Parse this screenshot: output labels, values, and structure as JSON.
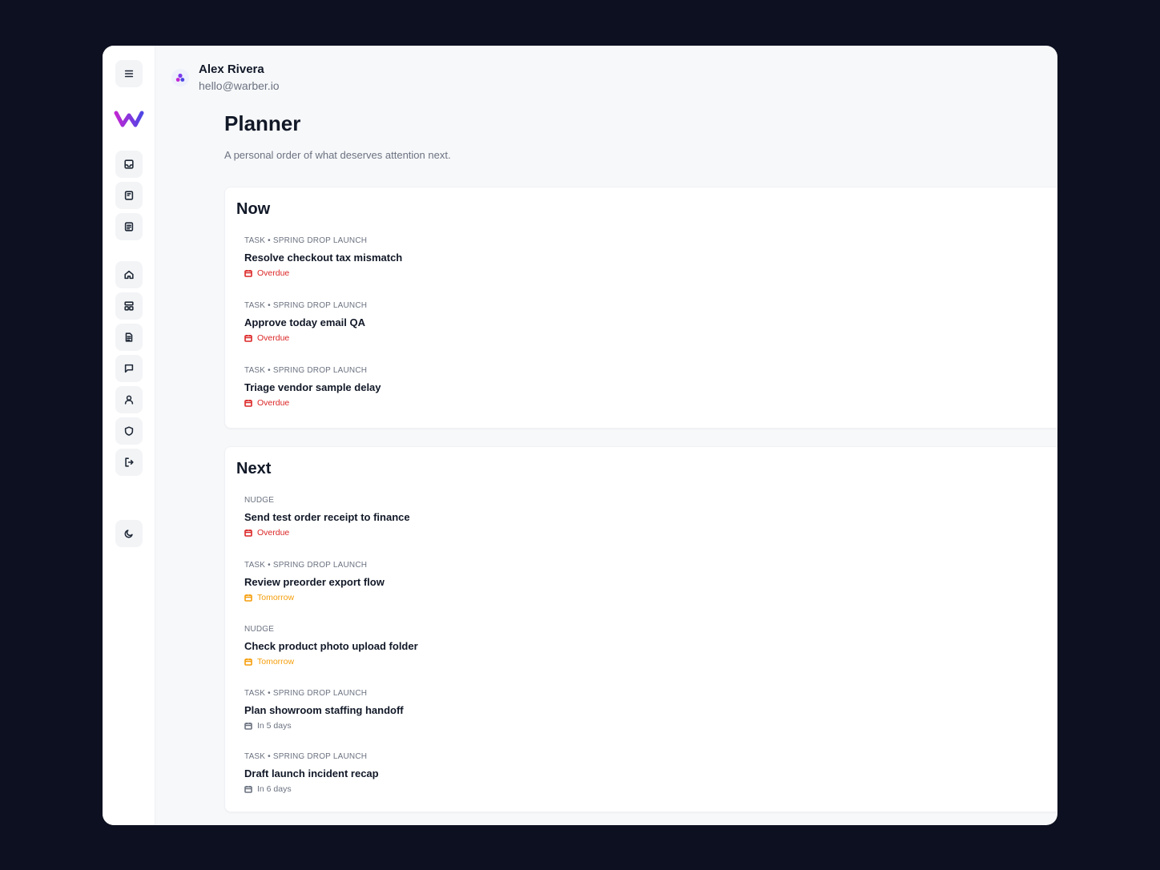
{
  "user": {
    "name": "Alex Rivera",
    "email": "hello@warber.io"
  },
  "page": {
    "title": "Planner",
    "subtitle": "A personal order of what deserves attention next."
  },
  "sidebar": {
    "icons": [
      "menu-icon",
      "inbox-icon",
      "bookmark-icon",
      "notes-icon",
      "home-icon",
      "dashboard-icon",
      "document-icon",
      "chat-icon",
      "user-icon",
      "shield-icon",
      "logout-icon",
      "moon-icon"
    ]
  },
  "sections": {
    "now": {
      "title": "Now",
      "items": [
        {
          "meta": "TASK • SPRING DROP LAUNCH",
          "title": "Resolve checkout tax mismatch",
          "due": "Overdue",
          "due_status": "overdue"
        },
        {
          "meta": "TASK • SPRING DROP LAUNCH",
          "title": "Approve today email QA",
          "due": "Overdue",
          "due_status": "overdue"
        },
        {
          "meta": "TASK • SPRING DROP LAUNCH",
          "title": "Triage vendor sample delay",
          "due": "Overdue",
          "due_status": "overdue"
        }
      ]
    },
    "next": {
      "title": "Next",
      "items": [
        {
          "meta": "NUDGE",
          "title": "Send test order receipt to finance",
          "due": "Overdue",
          "due_status": "overdue"
        },
        {
          "meta": "TASK • SPRING DROP LAUNCH",
          "title": "Review preorder export flow",
          "due": "Tomorrow",
          "due_status": "tomorrow"
        },
        {
          "meta": "NUDGE",
          "title": "Check product photo upload folder",
          "due": "Tomorrow",
          "due_status": "tomorrow"
        },
        {
          "meta": "TASK • SPRING DROP LAUNCH",
          "title": "Plan showroom staffing handoff",
          "due": "In 5 days",
          "due_status": "later"
        },
        {
          "meta": "TASK • SPRING DROP LAUNCH",
          "title": "Draft launch incident recap",
          "due": "In 6 days",
          "due_status": "later"
        }
      ]
    }
  },
  "colors": {
    "background": "#0d1020",
    "overdue": "#dc2626",
    "tomorrow": "#f59e0b",
    "later": "#6b7280",
    "logo_start": "#c026d3",
    "logo_end": "#4f46e5"
  }
}
